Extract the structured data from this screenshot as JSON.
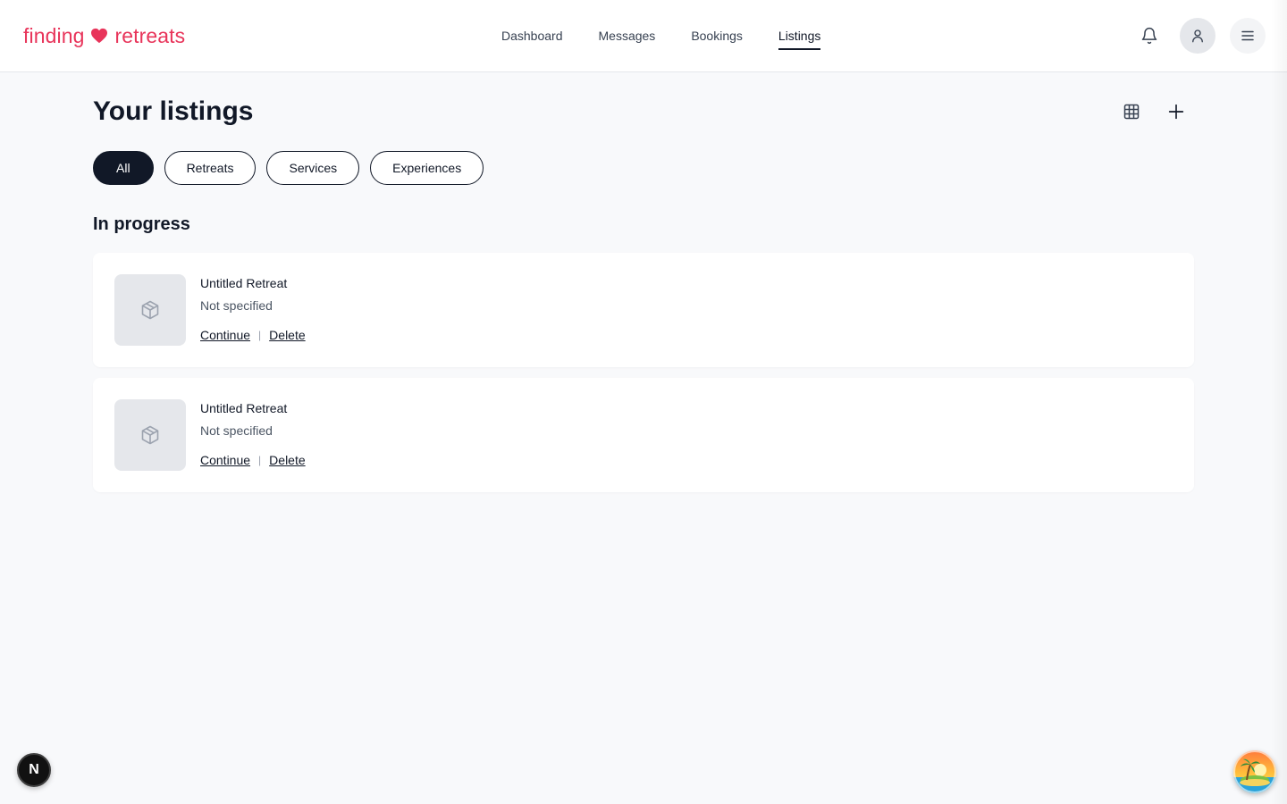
{
  "brand": {
    "word1": "finding",
    "word2": "retreats",
    "color": "#e8345a"
  },
  "nav": {
    "items": [
      {
        "label": "Dashboard"
      },
      {
        "label": "Messages"
      },
      {
        "label": "Bookings"
      },
      {
        "label": "Listings",
        "active": true
      }
    ]
  },
  "header_icons": [
    "bell-icon",
    "user-icon",
    "hamburger-menu-icon"
  ],
  "page": {
    "title": "Your listings",
    "toolbar_icons": [
      "grid-view-icon",
      "plus-icon"
    ],
    "filters": [
      {
        "label": "All",
        "active": true
      },
      {
        "label": "Retreats"
      },
      {
        "label": "Services"
      },
      {
        "label": "Experiences"
      }
    ],
    "section_title": "In progress",
    "listings": [
      {
        "title": "Untitled Retreat",
        "subtitle": "Not specified",
        "continue_label": "Continue",
        "delete_label": "Delete",
        "thumb_icon": "package-icon"
      },
      {
        "title": "Untitled Retreat",
        "subtitle": "Not specified",
        "continue_label": "Continue",
        "delete_label": "Delete",
        "thumb_icon": "package-icon"
      }
    ],
    "action_separator": "|"
  },
  "widgets": {
    "next_badge": "N",
    "assistant_icon": "palm-island-icon"
  }
}
